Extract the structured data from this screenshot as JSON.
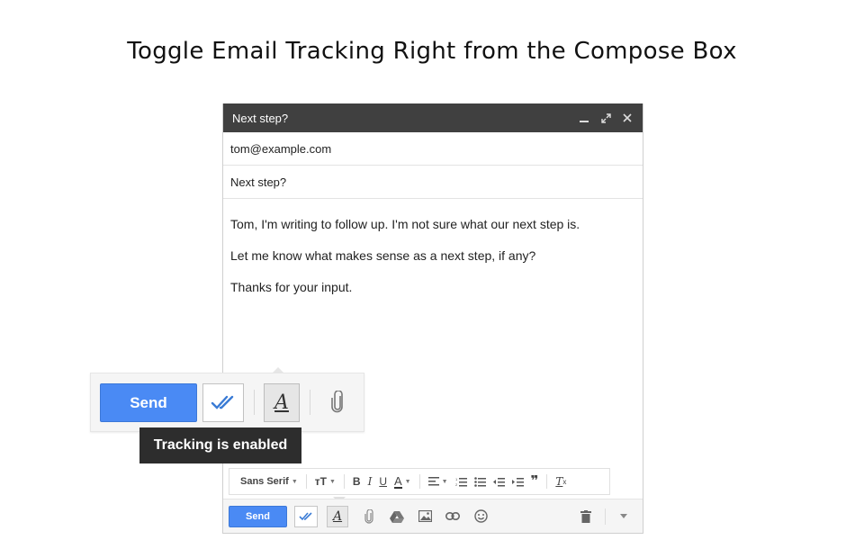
{
  "headline": "Toggle Email Tracking Right from the Compose Box",
  "compose": {
    "title": "Next step?",
    "to": "tom@example.com",
    "subject": "Next step?",
    "body": [
      "Tom, I'm writing to follow up. I'm not sure what our next step is.",
      "Let me know what makes sense as a next step, if any?",
      "Thanks for your input."
    ]
  },
  "format_bar": {
    "font": "Sans Serif"
  },
  "bottom_bar": {
    "send_label": "Send"
  },
  "zoom": {
    "send_label": "Send",
    "format_label": "A",
    "tooltip": "Tracking is enabled"
  },
  "colors": {
    "send_blue": "#4a8af4",
    "header_dark": "#404040",
    "tooltip_bg": "#2d2d2d"
  }
}
